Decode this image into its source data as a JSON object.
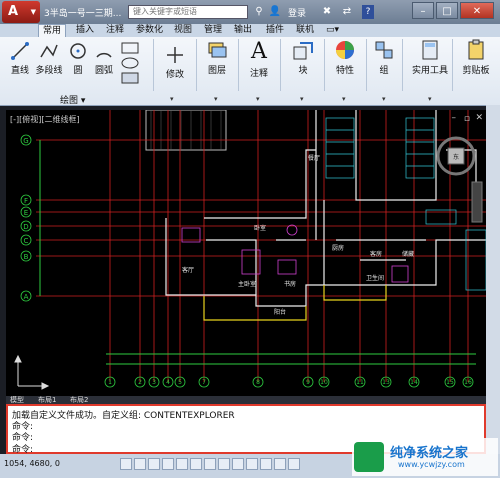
{
  "titlebar": {
    "app_letter": "A",
    "doc_title": "3半岛一号一三期...",
    "search_placeholder": "键入关键字或短语",
    "login": "登录",
    "help": "?",
    "minimize": "–",
    "maximize": "□",
    "close": "✕"
  },
  "tabs": [
    "常用",
    "插入",
    "注释",
    "参数化",
    "视图",
    "管理",
    "输出",
    "插件",
    "联机"
  ],
  "ribbon": {
    "draw_tools": [
      "直线",
      "多段线",
      "圆",
      "圆弧"
    ],
    "modify": "修改",
    "layers": "图层",
    "annotation": "注释",
    "block": "块",
    "properties": "特性",
    "group": "组",
    "utilities": "实用工具",
    "clipboard": "剪贴板",
    "panel_label": "绘图"
  },
  "viewport": {
    "label": "[-][俯视][二维线框]",
    "axis_letters_left": [
      "G",
      "F",
      "E",
      "D",
      "C",
      "B",
      "A"
    ],
    "axis_numbers_bottom": [
      "1",
      "2",
      "3",
      "4",
      "5",
      "7",
      "8",
      "9",
      "10",
      "11",
      "13",
      "14",
      "15",
      "16"
    ],
    "room_labels": [
      "客厅",
      "主卧室",
      "书房",
      "卧室",
      "卫生间",
      "餐厅",
      "储藏",
      "阳台",
      "厨房",
      "客房"
    ],
    "nav_label": "东"
  },
  "layout_tabs": [
    "模型",
    "布局1",
    "布局2"
  ],
  "command": {
    "line1": "加载自定义文件成功。自定义组: CONTENTEXPLORER",
    "line2": "命令:",
    "line3": "命令:",
    "prompt": "命令:"
  },
  "status": {
    "coords": "1054, 4680, 0"
  },
  "watermark": {
    "title": "纯净系统之家",
    "url": "www.ycwjzy.com"
  }
}
